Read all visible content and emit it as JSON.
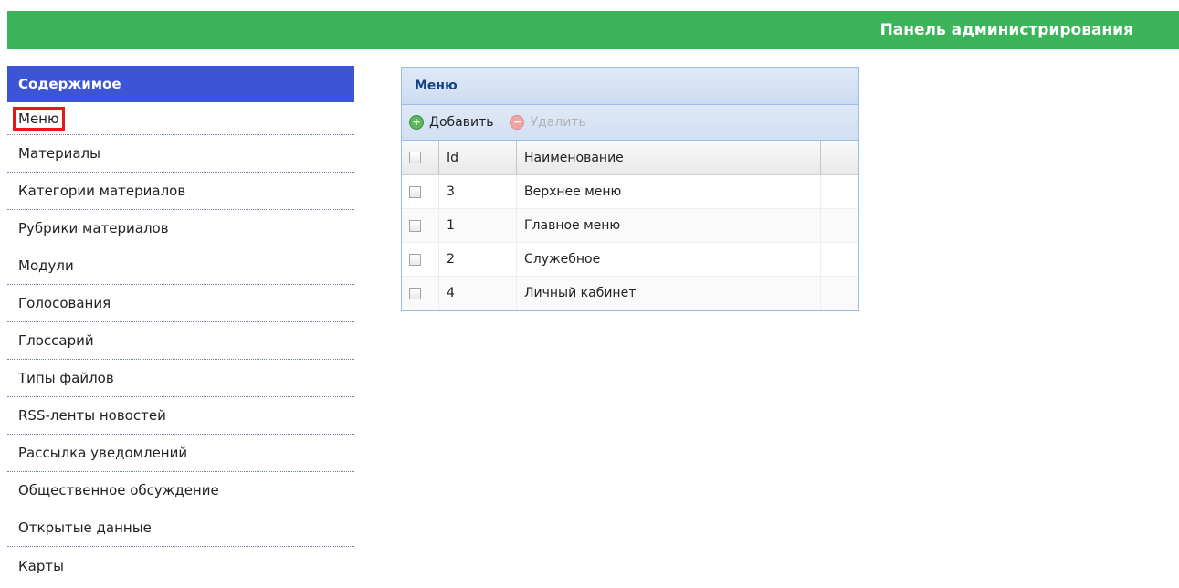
{
  "header": {
    "title": "Панель администрирования"
  },
  "sidebar": {
    "heading": "Содержимое",
    "items": [
      {
        "label": "Меню",
        "active": true
      },
      {
        "label": "Материалы"
      },
      {
        "label": "Категории материалов"
      },
      {
        "label": "Рубрики материалов"
      },
      {
        "label": "Модули"
      },
      {
        "label": "Голосования"
      },
      {
        "label": "Глоссарий"
      },
      {
        "label": "Типы файлов"
      },
      {
        "label": "RSS-ленты новостей"
      },
      {
        "label": "Рассылка уведомлений"
      },
      {
        "label": "Общественное обсуждение"
      },
      {
        "label": "Открытые данные"
      },
      {
        "label": "Карты"
      }
    ]
  },
  "panel": {
    "title": "Меню",
    "toolbar": {
      "add_label": "Добавить",
      "add_icon": "plus-circle-icon",
      "delete_label": "Удалить",
      "delete_icon": "minus-circle-icon"
    },
    "columns": {
      "id": "Id",
      "name": "Наименование"
    },
    "rows": [
      {
        "id": "3",
        "name": "Верхнее меню"
      },
      {
        "id": "1",
        "name": "Главное меню"
      },
      {
        "id": "2",
        "name": "Служебное"
      },
      {
        "id": "4",
        "name": "Личный кабинет"
      }
    ]
  },
  "colors": {
    "header_bg": "#3cb55a",
    "sidebar_heading_bg": "#3c55d6",
    "active_outline": "#e41919",
    "panel_border": "#99bbe8"
  }
}
